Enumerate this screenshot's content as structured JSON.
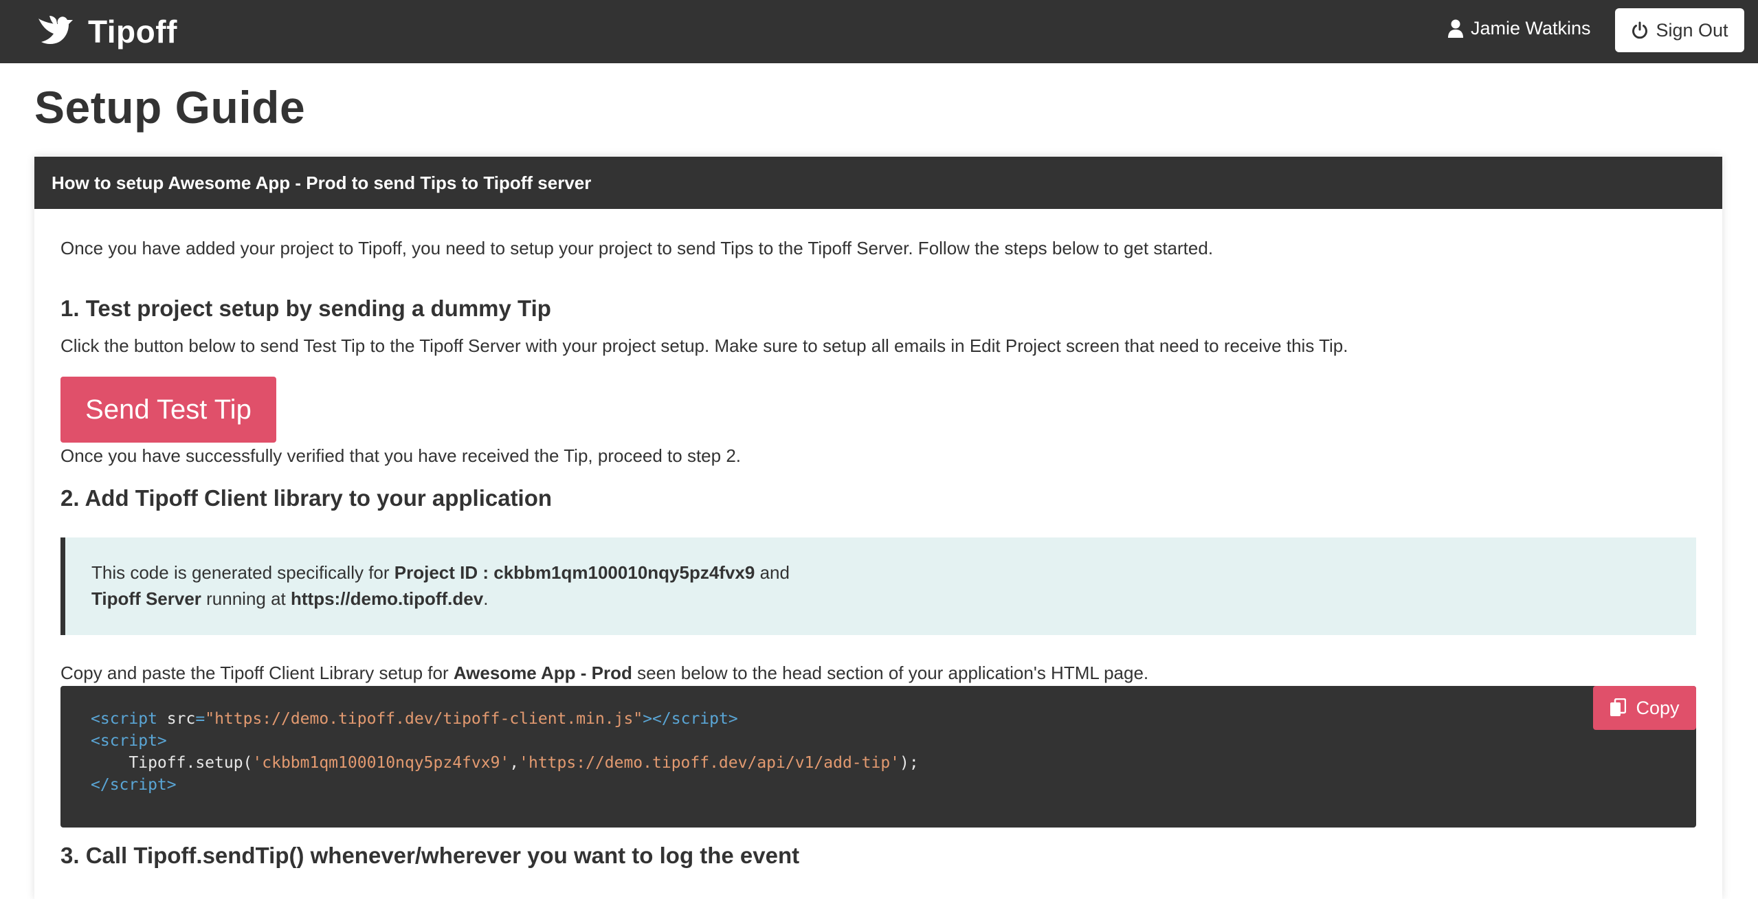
{
  "navbar": {
    "brand": "Tipoff",
    "user_name": "Jamie Watkins",
    "sign_out_label": "Sign Out"
  },
  "page": {
    "title": "Setup Guide"
  },
  "card": {
    "header": "How to setup Awesome App - Prod to send Tips to Tipoff server",
    "intro": "Once you have added your project to Tipoff, you need to setup your project to send Tips to the Tipoff Server. Follow the steps below to get started.",
    "step1": {
      "heading": "1. Test project setup by sending a dummy Tip",
      "description": "Click the button below to send Test Tip to the Tipoff Server with your project setup. Make sure to setup all emails in Edit Project screen that need to receive this Tip.",
      "button_label": "Send Test Tip",
      "after_text": "Once you have successfully verified that you have received the Tip, proceed to step 2."
    },
    "step2": {
      "heading": "2. Add Tipoff Client library to your application",
      "note": {
        "text1": "This code is generated specifically for ",
        "project_id_label": "Project ID : ckbbm1qm100010nqy5pz4fvx9",
        "text2": " and",
        "server_label": "Tipoff Server",
        "text3": " running at ",
        "server_url": "https://demo.tipoff.dev",
        "text4": "."
      },
      "instruction": {
        "text1": "Copy and paste the Tipoff Client Library setup for ",
        "app_name": "Awesome App - Prod",
        "text2": " seen below to the head section of your application's HTML page."
      },
      "code": {
        "script_src": "https://demo.tipoff.dev/tipoff-client.min.js",
        "setup_call": "Tipoff.setup(",
        "project_id": "'ckbbm1qm100010nqy5pz4fvx9'",
        "api_url": "'https://demo.tipoff.dev/api/v1/add-tip'",
        "close": ");"
      },
      "copy_label": "Copy"
    },
    "step3": {
      "heading": "3. Call Tipoff.sendTip() whenever/wherever you want to log the event"
    }
  },
  "colors": {
    "navbar_bg": "#333333",
    "accent": "#e0506a",
    "note_bg": "#e4f2f2"
  }
}
